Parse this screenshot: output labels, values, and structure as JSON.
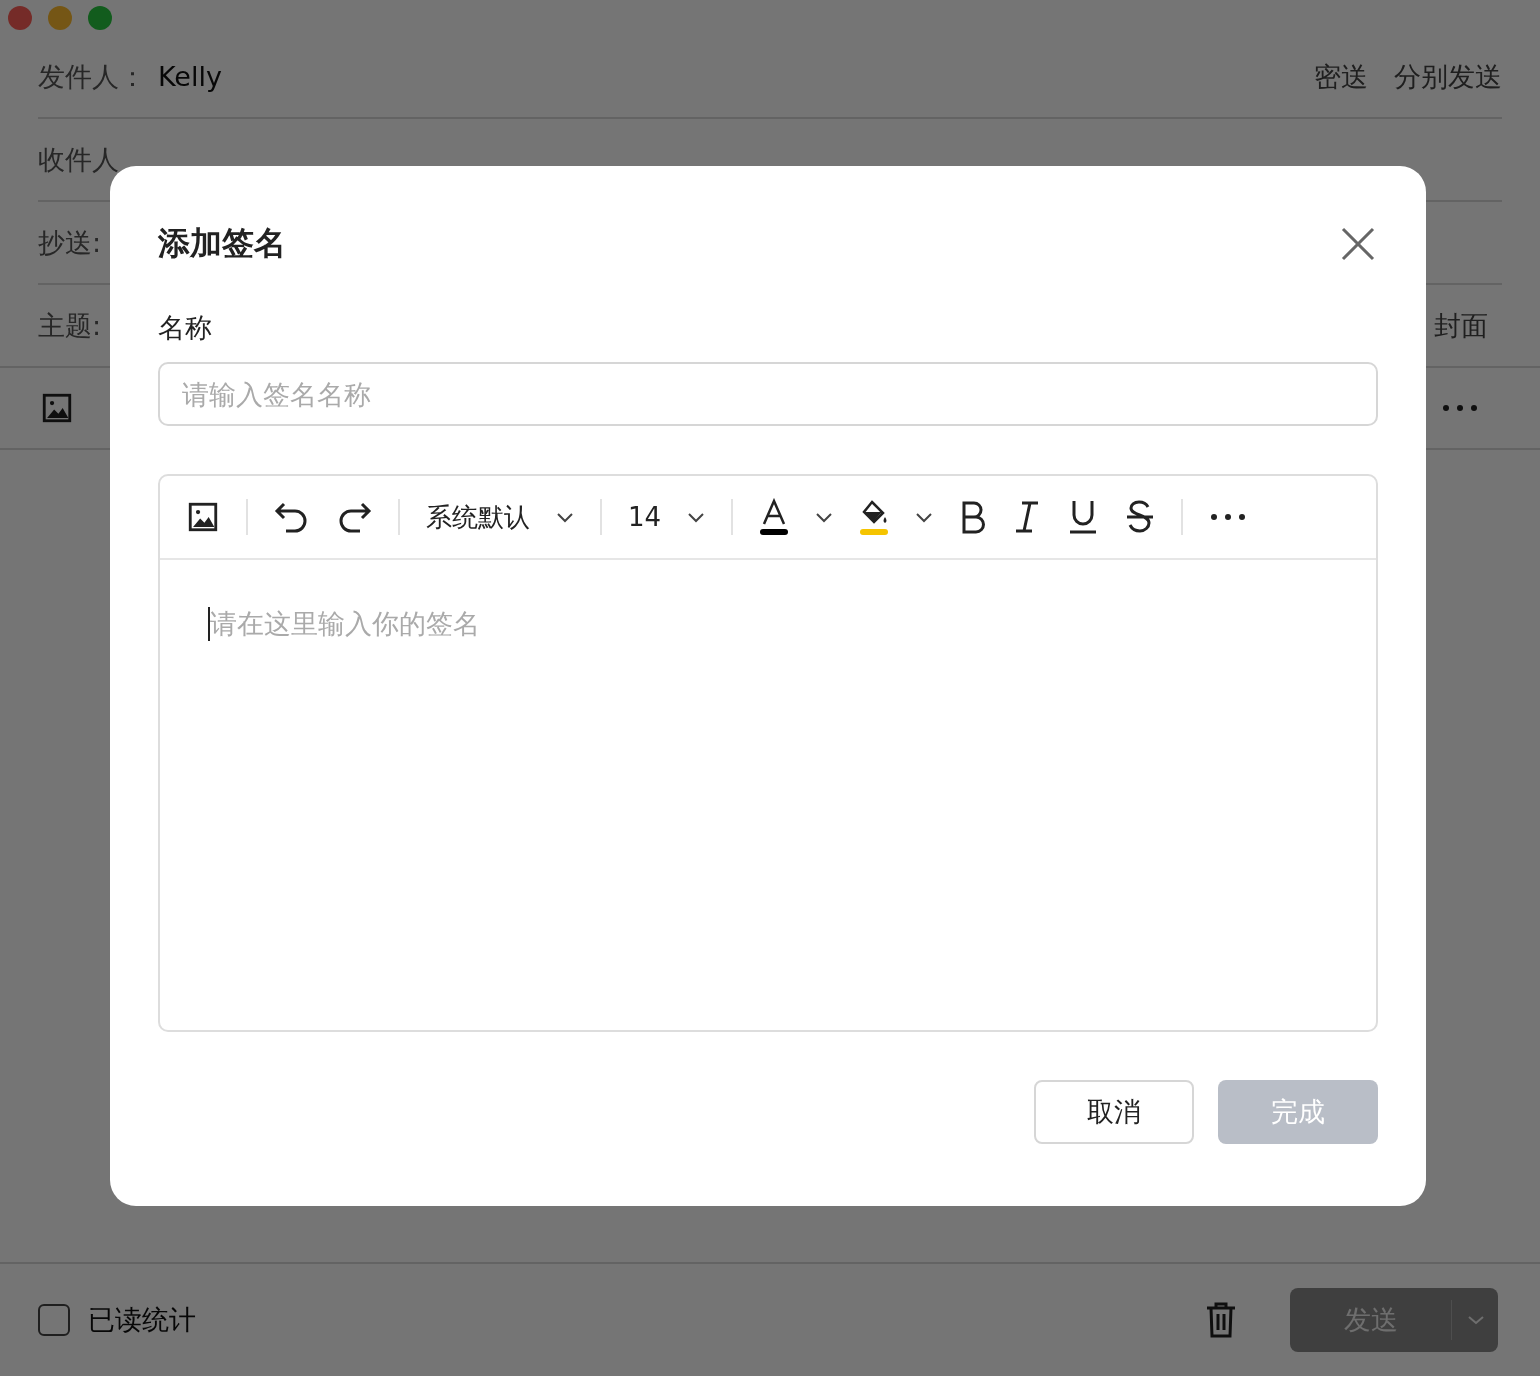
{
  "compose": {
    "from_label": "发件人：",
    "from_value": "Kelly",
    "header_links": [
      "密送",
      "分别发送"
    ],
    "to_label": "收件人",
    "cc_label": "抄送:",
    "subject_label": "主题:",
    "cover_link": "封面"
  },
  "bottom_bar": {
    "read_receipt": {
      "label": "已读统计",
      "checked": false
    },
    "send_button": {
      "label": "发送",
      "disabled": true
    }
  },
  "dialog": {
    "title": "添加签名",
    "name_label": "名称",
    "name_field": {
      "placeholder": "请输入签名名称"
    },
    "toolbar": {
      "font": "系统默认",
      "size": "14"
    },
    "editor": {
      "placeholder": "请在这里输入你的签名"
    },
    "cancel_button": {
      "label": "取消"
    },
    "done_button": {
      "label": "完成",
      "disabled": true
    }
  }
}
